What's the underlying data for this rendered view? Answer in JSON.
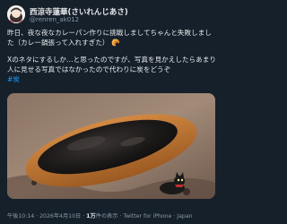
{
  "author": {
    "display_name": "西涼寺蓮華(さいれんじあさ)",
    "handle": "@renren_ak012"
  },
  "tweet": {
    "line1": "昨日、夜な夜なカレーパン作りに挑戦しましてちゃんと失敗しました（カレー鍋張って入れすぎた）",
    "emoji": "🥐",
    "line2": "Xのネタにするしか…と思ったのですが、写真を見かえしたらあまり人に見せる写真ではなかったので代わりに炭をどうぞ",
    "hashtag": "#炭"
  },
  "footer": {
    "time": "午後10:14",
    "date": "2026年4月10日",
    "views_count": "1万",
    "views_label": "件の表示",
    "source": "Twitter for iPhone · Japan",
    "separator": "·"
  },
  "colors": {
    "background": "#15202b",
    "text": "#e7e9ea",
    "secondary_text": "#8b98a5",
    "link": "#1d9bf0"
  }
}
